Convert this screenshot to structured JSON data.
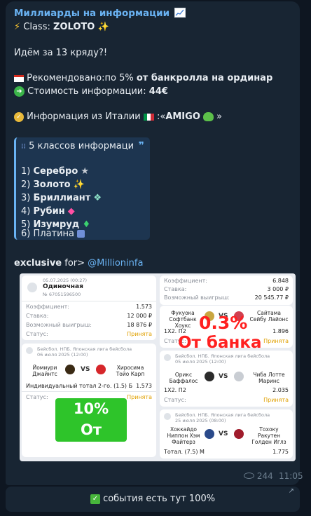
{
  "channel": {
    "name": "Миллиарды на информации"
  },
  "post": {
    "class_label": "Class:",
    "class_value": "ZOLOTO",
    "intro": "Идём за 13 кряду?!",
    "rec_prefix": "Рекомендовано:по 5%",
    "rec_bold": "от банкролла  на ординар",
    "price_prefix": "Стоимость информации:",
    "price_value": "44€",
    "source_prefix": "Информация из Италии",
    "source_sep": ":«",
    "source_name": "AMIGO",
    "source_suffix": "»"
  },
  "quote": {
    "header": "5 классов информаци",
    "items": [
      {
        "n": "1)",
        "name": "Серебро"
      },
      {
        "n": "2)",
        "name": "Золото"
      },
      {
        "n": "3)",
        "name": "Бриллиант"
      },
      {
        "n": "4)",
        "name": "Рубин"
      },
      {
        "n": "5)",
        "name": "Изумруд"
      },
      {
        "n": "6)",
        "name": "Платина"
      }
    ]
  },
  "footer": {
    "exclusive": "exclusive",
    "for_text": "for>",
    "mention": "@Millioninfa"
  },
  "screenshot": {
    "left_panel": {
      "date": "05.07.2025 (00:27)",
      "type": "Одиночная",
      "number": "№ 67051596500",
      "coef_label": "Коэффициент:",
      "coef_value": "1.573",
      "stake_label": "Ставка:",
      "stake_value": "12 000 ₽",
      "win_label": "Возможный выигрыш:",
      "win_value": "18 876 ₽",
      "status_label": "Статус:",
      "status_value": "Принята",
      "league": "Бейсбол. НПБ. Японская лига бейсбола",
      "match_date": "06 июля 2025 (12:00)",
      "team1": "Йомиури Джайнтс",
      "team2": "Хиросима Тойо Карп",
      "vs": "VS",
      "bet": "Индивидуальный тотал 2-го. (1.5) Б",
      "bet_coef": "1.573",
      "status2_label": "Статус:",
      "status2_value": "Принята",
      "badge_pct": "10%",
      "badge_text": "От банка"
    },
    "right_panel": {
      "coef_label": "Коэффициент:",
      "coef_value": "6.848",
      "stake_label": "Ставка:",
      "stake_value": "3 000 ₽",
      "win_label": "Возможный выигрыш:",
      "win_value": "20 545.77 ₽",
      "m1_team1": "Фукуока Софтбанк Хоукс",
      "m1_team2": "Сайтама Сейбу Лайонс",
      "m1_bet": "1X2. П2",
      "m1_coef": "1.896",
      "m1_status_label": "Статус:",
      "m1_status": "Принята",
      "m2_league": "Бейсбол. НПБ. Японская лига бейсбола",
      "m2_date": "05 июля 2025 (12:00)",
      "m2_team1": "Орикс Баффалос",
      "m2_team2": "Чиба Лотте Маринс",
      "m2_bet": "1X2. П2",
      "m2_coef": "2.035",
      "m2_status_label": "Статус:",
      "m2_status": "Принята",
      "m3_league": "Бейсбол. НПБ. Японская лига бейсбола",
      "m3_date": "25 июля 2025 (08:00)",
      "m3_team1": "Хоккайдо Ниппон Хэм Файтерз",
      "m3_team2": "Тохоку Ракутен Голден Иглз",
      "m3_bet": "Тотал. (7.5) М",
      "m3_coef": "1.775",
      "red_pct": "0.3%",
      "red_text": "От банка",
      "vs": "VS"
    }
  },
  "meta": {
    "views": "244",
    "time": "11:05"
  },
  "button": {
    "label": "события есть тут 100%"
  },
  "colors": {
    "bg": "#0e1621",
    "bubble": "#182533",
    "accent": "#6ab3f3",
    "green": "#2ec42a",
    "red": "#ff2020"
  }
}
